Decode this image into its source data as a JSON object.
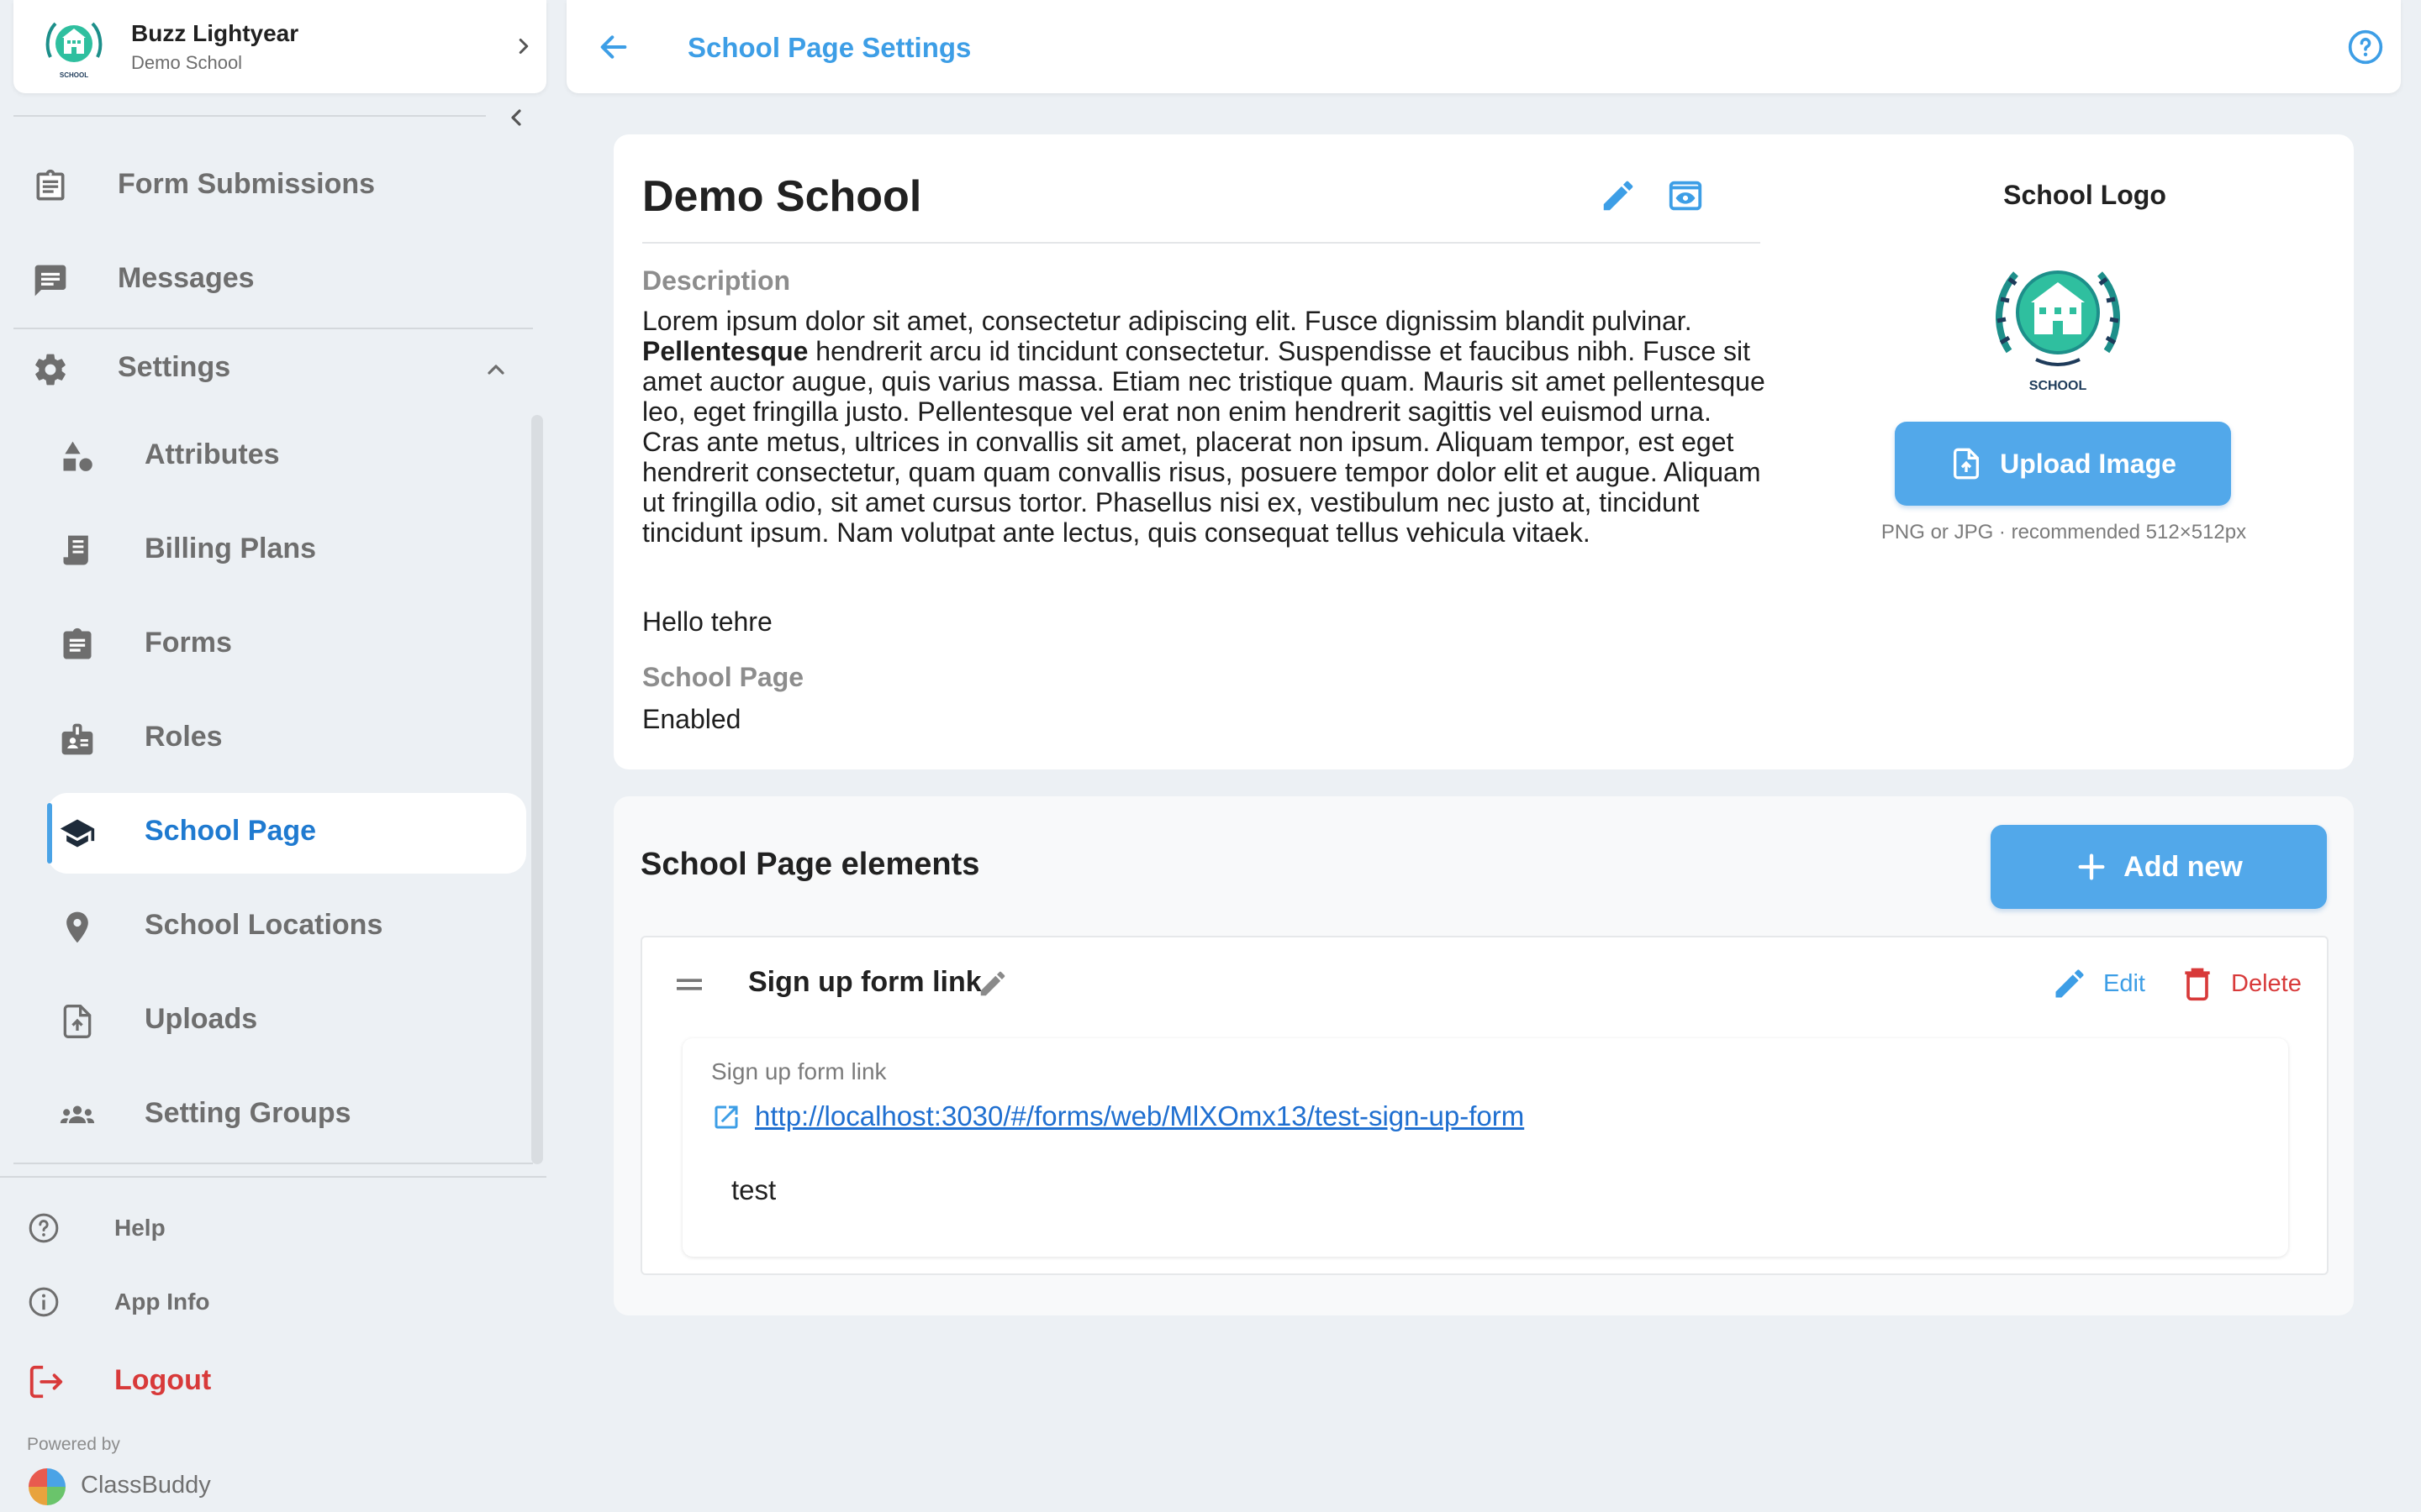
{
  "user": {
    "name": "Buzz Lightyear",
    "school": "Demo School",
    "logo_text": "SCHOOL"
  },
  "nav": {
    "form_submissions": "Form Submissions",
    "messages": "Messages",
    "settings": "Settings",
    "attributes": "Attributes",
    "billing_plans": "Billing Plans",
    "forms": "Forms",
    "roles": "Roles",
    "school_page": "School Page",
    "school_locations": "School Locations",
    "uploads": "Uploads",
    "setting_groups": "Setting Groups"
  },
  "footer": {
    "help": "Help",
    "app_info": "App Info",
    "logout": "Logout",
    "powered_by": "Powered by",
    "brand": "ClassBuddy"
  },
  "header": {
    "title": "School Page Settings"
  },
  "school": {
    "name": "Demo School",
    "description_label": "Description",
    "description_pre": "Lorem ipsum dolor sit amet, consectetur adipiscing elit. Fusce dignissim blandit pulvinar. ",
    "description_bold": "Pellentesque",
    "description_post": " hendrerit arcu id tincidunt consectetur. Suspendisse et faucibus nibh. Fusce sit amet auctor augue, quis varius massa. Etiam nec tristique quam. Mauris sit amet pellentesque leo, eget fringilla justo. Pellentesque vel erat non enim hendrerit sagittis vel euismod urna. Cras ante metus, ultrices in convallis sit amet, placerat non ipsum. Aliquam tempor, est eget hendrerit consectetur, quam quam convallis risus, posuere tempor dolor elit et augue. Aliquam ut fringilla odio, sit amet cursus tortor. Phasellus nisi ex, vestibulum nec justo at, tincidunt tincidunt ipsum. Nam volutpat ante lectus, quis consequat tellus vehicula vitaek.",
    "description_extra": "Hello tehre",
    "page_label": "School Page",
    "page_status": "Enabled"
  },
  "logo": {
    "heading": "School Logo",
    "upload_label": "Upload Image",
    "hint": "PNG or JPG · recommended 512×512px",
    "logo_text": "SCHOOL"
  },
  "elements": {
    "title": "School Page elements",
    "add_label": "Add new",
    "items": [
      {
        "title": "Sign up form link",
        "edit_label": "Edit",
        "delete_label": "Delete",
        "field_label": "Sign up form link",
        "url": "http://localhost:3030/#/forms/web/MlXOmx13/test-sign-up-form",
        "text": "test"
      }
    ]
  },
  "colors": {
    "accent": "#3d9ee6",
    "button": "#52a8ea",
    "danger": "#d83a3a",
    "background": "#ecf0f4"
  }
}
